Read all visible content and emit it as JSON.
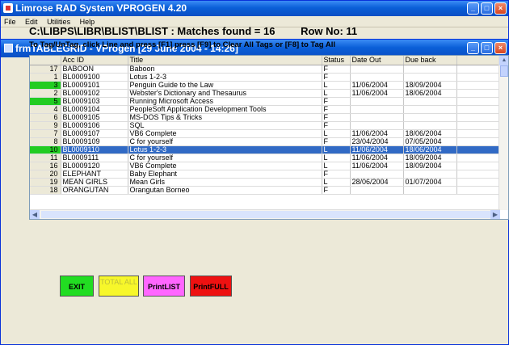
{
  "outer_window": {
    "title": "Limrose RAD System   VPROGEN 4.20",
    "menu": [
      "File",
      "Edit",
      "Utilities",
      "Help"
    ]
  },
  "inner_window": {
    "title": "frmTABLEGRID - VProgen     [29 June 2004 - 14:26]"
  },
  "header": {
    "path": "C:\\LIBPS\\LIBR\\BLIST\\BLIST : Matches found = 16",
    "row_no": "Row No: 11",
    "instructions": "To Tag/UnTag, click Line and press [F1]    press [F9] to Clear All Tags or [F8] to Tag All"
  },
  "grid": {
    "columns": [
      "",
      "Acc ID",
      "Title",
      "Status",
      "Date Out",
      "Due back",
      ""
    ],
    "rows": [
      {
        "num": "17",
        "acc": "BABOON",
        "title": "Baboon",
        "status": "F",
        "date_out": "",
        "due_back": "",
        "tagged": false,
        "selected": false
      },
      {
        "num": "1",
        "acc": "BL0009100",
        "title": "Lotus 1-2-3",
        "status": "F",
        "date_out": "",
        "due_back": "",
        "tagged": false,
        "selected": false
      },
      {
        "num": "3",
        "acc": "BL0009101",
        "title": "Penguin Guide to the Law",
        "status": "L",
        "date_out": "11/06/2004",
        "due_back": "18/09/2004",
        "tagged": true,
        "selected": false
      },
      {
        "num": "2",
        "acc": "BL0009102",
        "title": "Webster's Dictionary and Thesaurus",
        "status": "L",
        "date_out": "11/06/2004",
        "due_back": "18/06/2004",
        "tagged": false,
        "selected": false
      },
      {
        "num": "5",
        "acc": "BL0009103",
        "title": "Running Microsoft Access",
        "status": "F",
        "date_out": "",
        "due_back": "",
        "tagged": true,
        "selected": false
      },
      {
        "num": "4",
        "acc": "BL0009104",
        "title": "PeopleSoft Application Development Tools",
        "status": "F",
        "date_out": "",
        "due_back": "",
        "tagged": false,
        "selected": false
      },
      {
        "num": "6",
        "acc": "BL0009105",
        "title": "MS-DOS Tips & Tricks",
        "status": "F",
        "date_out": "",
        "due_back": "",
        "tagged": false,
        "selected": false
      },
      {
        "num": "9",
        "acc": "BL0009106",
        "title": "SQL",
        "status": "F",
        "date_out": "",
        "due_back": "",
        "tagged": false,
        "selected": false
      },
      {
        "num": "7",
        "acc": "BL0009107",
        "title": "VB6 Complete",
        "status": "L",
        "date_out": "11/06/2004",
        "due_back": "18/06/2004",
        "tagged": false,
        "selected": false
      },
      {
        "num": "8",
        "acc": "BL0009109",
        "title": "C for yourself",
        "status": "F",
        "date_out": "23/04/2004",
        "due_back": "07/05/2004",
        "tagged": false,
        "selected": false
      },
      {
        "num": "10",
        "acc": "BL0009110",
        "title": "Lotus 1-2-3",
        "status": "L",
        "date_out": "11/06/2004",
        "due_back": "18/06/2004",
        "tagged": true,
        "selected": true
      },
      {
        "num": "11",
        "acc": "BL0009111",
        "title": "C for yourself",
        "status": "L",
        "date_out": "11/06/2004",
        "due_back": "18/09/2004",
        "tagged": false,
        "selected": false
      },
      {
        "num": "16",
        "acc": "BL0009120",
        "title": "VB6 Complete",
        "status": "L",
        "date_out": "11/06/2004",
        "due_back": "18/09/2004",
        "tagged": false,
        "selected": false
      },
      {
        "num": "20",
        "acc": "ELEPHANT",
        "title": "Baby Elephant",
        "status": "F",
        "date_out": "",
        "due_back": "",
        "tagged": false,
        "selected": false
      },
      {
        "num": "19",
        "acc": "MEAN GIRLS",
        "title": "Mean Girls",
        "status": "L",
        "date_out": "28/06/2004",
        "due_back": "01/07/2004",
        "tagged": false,
        "selected": false
      },
      {
        "num": "18",
        "acc": "ORANGUTAN",
        "title": "Orangutan Borneo",
        "status": "F",
        "date_out": "",
        "due_back": "",
        "tagged": false,
        "selected": false
      }
    ]
  },
  "buttons": {
    "exit": "EXIT",
    "total_all": "TOTAL ALL",
    "print_list": "PrintLIST",
    "print_full": "PrintFULL"
  },
  "colors": {
    "tag_green": "#22cc22",
    "selection_blue": "#316ac5",
    "exit_green": "#22dd22",
    "total_yellow": "#f7f72a",
    "printlist_magenta": "#ff66ff",
    "printfull_red": "#ee1111"
  },
  "icons": [
    "app-icon",
    "minimize-icon",
    "maximize-icon",
    "close-icon",
    "scroll-up-icon",
    "scroll-left-icon",
    "scroll-right-icon"
  ]
}
